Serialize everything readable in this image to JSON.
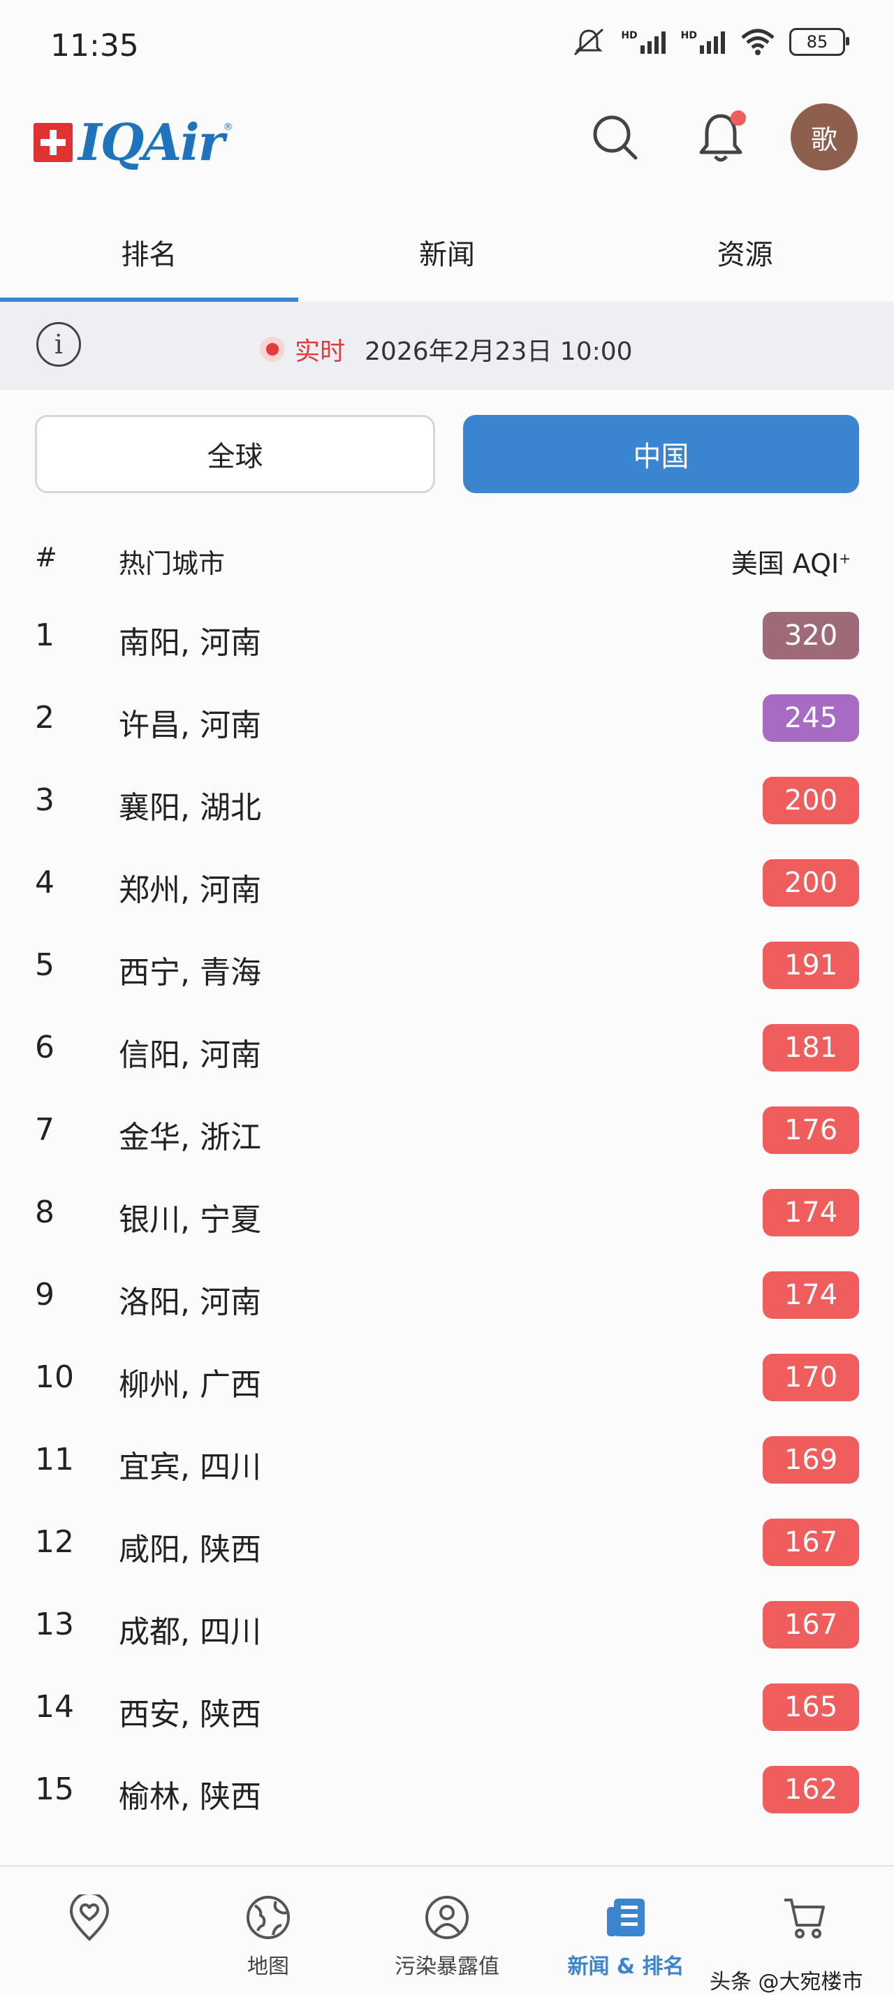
{
  "status_bar": {
    "time": "11:35",
    "network_label_1": "HD",
    "network_label_2": "HD",
    "battery": "85"
  },
  "header": {
    "brand": "IQAir",
    "registered_mark": "®",
    "avatar_initial": "歌",
    "icons": [
      "search-icon",
      "bell-icon"
    ],
    "notification_dot_color": "#f05d5d"
  },
  "tabs": [
    {
      "label": "排名",
      "active": true
    },
    {
      "label": "新闻",
      "active": false
    },
    {
      "label": "资源",
      "active": false
    }
  ],
  "realtime": {
    "info_glyph": "i",
    "live_label": "实时",
    "timestamp": "2026年2月23日 10:00"
  },
  "segment": {
    "global_label": "全球",
    "china_label": "中国",
    "selected": "中国"
  },
  "table": {
    "col_rank": "#",
    "col_city": "热门城市",
    "col_aqi": "美国 AQI",
    "col_aqi_sup": "+",
    "rows": [
      {
        "rank": "1",
        "city": "南阳, 河南",
        "aqi": "320",
        "color": "#9e6a78"
      },
      {
        "rank": "2",
        "city": "许昌, 河南",
        "aqi": "245",
        "color": "#a76bc3"
      },
      {
        "rank": "3",
        "city": "襄阳, 湖北",
        "aqi": "200",
        "color": "#f05d5d"
      },
      {
        "rank": "4",
        "city": "郑州, 河南",
        "aqi": "200",
        "color": "#f05d5d"
      },
      {
        "rank": "5",
        "city": "西宁, 青海",
        "aqi": "191",
        "color": "#f05d5d"
      },
      {
        "rank": "6",
        "city": "信阳, 河南",
        "aqi": "181",
        "color": "#f05d5d"
      },
      {
        "rank": "7",
        "city": "金华, 浙江",
        "aqi": "176",
        "color": "#f05d5d"
      },
      {
        "rank": "8",
        "city": "银川, 宁夏",
        "aqi": "174",
        "color": "#f05d5d"
      },
      {
        "rank": "9",
        "city": "洛阳, 河南",
        "aqi": "174",
        "color": "#f05d5d"
      },
      {
        "rank": "10",
        "city": "柳州, 广西",
        "aqi": "170",
        "color": "#f05d5d"
      },
      {
        "rank": "11",
        "city": "宜宾, 四川",
        "aqi": "169",
        "color": "#f05d5d"
      },
      {
        "rank": "12",
        "city": "咸阳, 陕西",
        "aqi": "167",
        "color": "#f05d5d"
      },
      {
        "rank": "13",
        "city": "成都, 四川",
        "aqi": "167",
        "color": "#f05d5d"
      },
      {
        "rank": "14",
        "city": "西安, 陕西",
        "aqi": "165",
        "color": "#f05d5d"
      },
      {
        "rank": "15",
        "city": "榆林, 陕西",
        "aqi": "162",
        "color": "#f05d5d"
      }
    ]
  },
  "bottom_nav": [
    {
      "label": "",
      "icon": "heart-location-icon",
      "active": false
    },
    {
      "label": "地图",
      "icon": "globe-icon",
      "active": false
    },
    {
      "label": "污染暴露值",
      "icon": "exposure-icon",
      "active": false
    },
    {
      "label": "新闻 & 排名",
      "icon": "news-icon",
      "active": true
    },
    {
      "label": "",
      "icon": "cart-icon",
      "active": false
    }
  ],
  "watermark": "头条 @大宛楼市",
  "colors": {
    "accent": "#3b84cf",
    "live_red": "#e53a3a",
    "unhealthy": "#f05d5d",
    "very_unhealthy": "#a76bc3",
    "hazardous": "#9e6a78"
  }
}
